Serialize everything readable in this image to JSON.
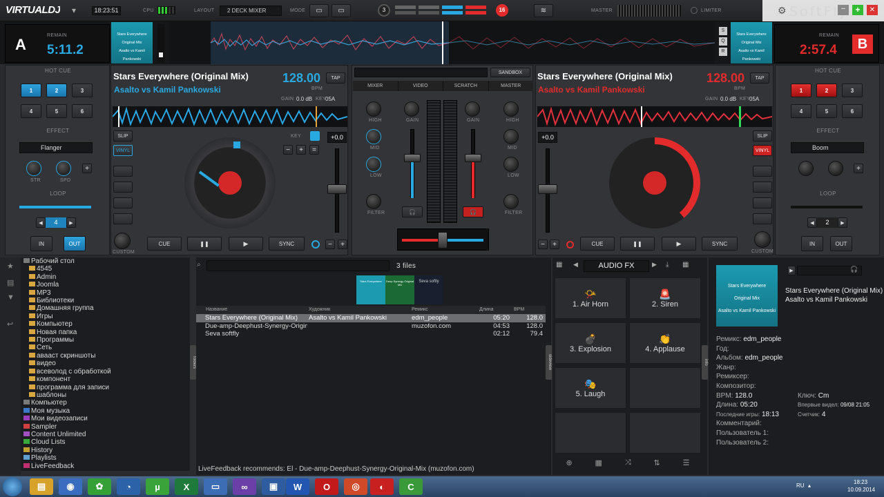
{
  "topbar": {
    "logo": "VIRTUALDJ",
    "clock": "18:23:51",
    "cpu_label": "CPU",
    "layout_label": "LAYOUT",
    "layout_value": "2 DECK MIXER",
    "mode_label": "MODE",
    "deck_left_num": "3",
    "deck_right_num": "16",
    "master_label": "MASTER",
    "limiter_label": "LIMITER",
    "watermark": "SoftFly"
  },
  "deckA": {
    "letter": "A",
    "remain_label": "REMAIN",
    "time": "5:11.2",
    "cover_lines": [
      "Stars Everywhere",
      "Original Mix",
      "Asalto vs Kamil Pankowski"
    ],
    "title": "Stars Everywhere (Original Mix)",
    "artist": "Asalto vs Kamil Pankowski",
    "bpm": "128.00",
    "bpm_label": "BPM",
    "tap": "TAP",
    "gain_label": "GAIN",
    "gain_value": "0.0 dB",
    "key_label": "KEY",
    "key_value": "05A",
    "hotcue_label": "HOT CUE",
    "hotcues": [
      "1",
      "2",
      "3",
      "4",
      "5",
      "6"
    ],
    "effect_label": "EFFECT",
    "effect": "Flanger",
    "str": "STR",
    "spd": "SPD",
    "loop_label": "LOOP",
    "loop_value": "4",
    "in": "IN",
    "out": "OUT",
    "slip": "SLIP",
    "vinyl": "VINYL",
    "custom": "CUSTOM",
    "key_btn": "KEY",
    "pitch": "+0.0",
    "cue": "CUE",
    "play": "▶",
    "pause": "❚❚",
    "sync": "SYNC"
  },
  "deckB": {
    "letter": "B",
    "remain_label": "REMAIN",
    "time": "2:57.4",
    "cover_lines": [
      "Stars Everywhere",
      "Original Mix",
      "Asalto vs Kamil Pankowski"
    ],
    "title": "Stars Everywhere (Original Mix)",
    "artist": "Asalto vs Kamil Pankowski",
    "bpm": "128.00",
    "bpm_label": "BPM",
    "tap": "TAP",
    "gain_label": "GAIN",
    "gain_value": "0.0 dB",
    "key_label": "KEY",
    "key_value": "05A",
    "hotcue_label": "HOT CUE",
    "hotcues": [
      "1",
      "2",
      "3",
      "4",
      "5",
      "6"
    ],
    "effect_label": "EFFECT",
    "effect": "Boom",
    "loop_label": "LOOP",
    "loop_value": "2",
    "in": "IN",
    "out": "OUT",
    "slip": "SLIP",
    "vinyl": "VINYL",
    "custom": "CUSTOM",
    "pitch": "+0.0",
    "cue": "CUE",
    "play": "▶",
    "pause": "❚❚",
    "sync": "SYNC",
    "side_letters": [
      "S",
      "Q",
      "R"
    ]
  },
  "mixer": {
    "sandbox": "SANDBOX",
    "tabs": [
      "MIXER",
      "VIDEO",
      "SCRATCH",
      "MASTER"
    ],
    "high": "HIGH",
    "mid": "MID",
    "low": "LOW",
    "filter": "FILTER",
    "gain": "GAIN"
  },
  "browser": {
    "tree": [
      "Рабочий стол",
      "4545",
      "Admin",
      "Joomla",
      "MP3",
      "Библиотеки",
      "Домашняя группа",
      "Игры",
      "Компьютер",
      "Новая папка",
      "Программы",
      "Сеть",
      "авааст скриншоты",
      "видео",
      "всеволод с обработкой",
      "компонент",
      "программа для записи",
      "шаблоны",
      "Компьютер",
      "Моя музыка",
      "Мои видеозаписи",
      "Sampler",
      "Content Unlimited",
      "Cloud Lists",
      "History",
      "Playlists",
      "LiveFeedback"
    ],
    "files_count": "3 files",
    "folders_tab": "folders",
    "sideview_tab": "sideview",
    "info_tab": "info",
    "thumb_labels": [
      "Stars Everywhere",
      "Deep Synergy Original Mix",
      "Seva softly"
    ],
    "columns": [
      "Название",
      "Художник",
      "Ремикс",
      "Длина",
      "BPM"
    ],
    "rows": [
      [
        "Stars Everywhere (Original Mix)",
        "Asalto vs Kamil Pankowski",
        "edm_people",
        "05:20",
        "128.0"
      ],
      [
        "Due-amp-Deephust-Synergy-Original-Mix El",
        "",
        "muzofon.com",
        "04:53",
        "128.0"
      ],
      [
        "Seva softfly",
        "",
        "",
        "02:12",
        "79.4"
      ]
    ],
    "recommend": "LiveFeedback recommends: El - Due-amp-Deephust-Synergy-Original-Mix (muzofon.com)"
  },
  "fx": {
    "title": "AUDIO FX",
    "items": [
      "1. Air Horn",
      "2. Siren",
      "3. Explosion",
      "4. Applause",
      "5. Laugh"
    ]
  },
  "info": {
    "cover_lines": [
      "Stars Everywhere",
      "Original Mix",
      "Asalto vs Kamil Pankowski"
    ],
    "title": "Stars Everywhere (Original Mix)",
    "artist": "Asalto vs Kamil Pankowski",
    "remix_l": "Ремикс:",
    "remix_v": "edm_people",
    "year_l": "Год:",
    "album_l": "Альбом:",
    "album_v": "edm_people",
    "genre_l": "Жанр:",
    "remixer_l": "Ремиксер:",
    "composer_l": "Композитор:",
    "bpm_l": "BPM:",
    "bpm_v": "128.0",
    "key_l": "Ключ:",
    "key_v": "Cm",
    "len_l": "Длина:",
    "len_v": "05:20",
    "first_l": "Впервые видел:",
    "first_v": "09/08 21:05",
    "last_l": "Последние игры:",
    "last_v": "18:13",
    "count_l": "Счетчик:",
    "count_v": "4",
    "comment_l": "Комментарий:",
    "user1_l": "Пользователь 1:",
    "user2_l": "Пользователь 2:"
  },
  "taskbar": {
    "lang": "RU",
    "time": "18:23",
    "date": "10.09.2014"
  },
  "colors": {
    "deckA": "#29a9e1",
    "deckB": "#e32b2b"
  }
}
